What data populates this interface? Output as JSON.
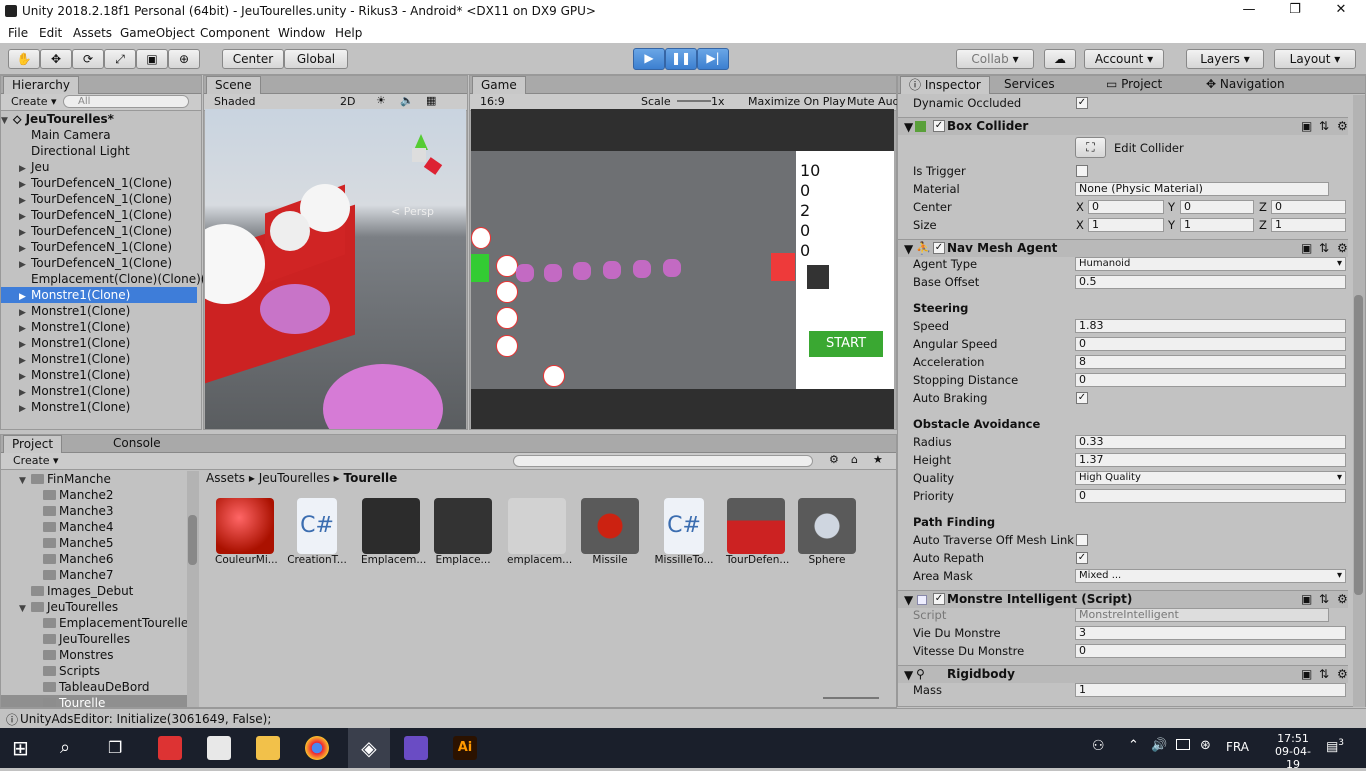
{
  "window": {
    "title": "Unity 2018.2.18f1 Personal (64bit) - JeuTourelles.unity - Rikus3 - Android* <DX11 on DX9 GPU>"
  },
  "menu": [
    "File",
    "Edit",
    "Assets",
    "GameObject",
    "Component",
    "Window",
    "Help"
  ],
  "toolbar": {
    "center": "Center",
    "global": "Global",
    "collab": "Collab",
    "account": "Account",
    "layers": "Layers",
    "layout": "Layout"
  },
  "hierarchy": {
    "tab": "Hierarchy",
    "create": "Create",
    "search_placeholder": "All",
    "scene": "JeuTourelles*",
    "items": [
      "Main Camera",
      "Directional Light",
      "Jeu",
      "TourDefenceN_1(Clone)",
      "TourDefenceN_1(Clone)",
      "TourDefenceN_1(Clone)",
      "TourDefenceN_1(Clone)",
      "TourDefenceN_1(Clone)",
      "TourDefenceN_1(Clone)",
      "Emplacement(Clone)(Clone)(",
      "Monstre1(Clone)",
      "Monstre1(Clone)",
      "Monstre1(Clone)",
      "Monstre1(Clone)",
      "Monstre1(Clone)",
      "Monstre1(Clone)",
      "Monstre1(Clone)",
      "Monstre1(Clone)"
    ]
  },
  "scene": {
    "tab": "Scene",
    "shading": "Shaded",
    "mode2d": "2D",
    "persp": "Persp"
  },
  "game": {
    "tab": "Game",
    "aspect": "16:9",
    "scale_label": "Scale",
    "scale_value": "1x",
    "maximize": "Maximize On Play",
    "mute": "Mute Aud",
    "scores": [
      "10",
      "0",
      "2",
      "0",
      "0"
    ],
    "start": "START"
  },
  "project": {
    "tab": "Project",
    "console_tab": "Console",
    "create": "Create",
    "tree": [
      "FinManche",
      "Manche2",
      "Manche3",
      "Manche4",
      "Manche5",
      "Manche6",
      "Manche7",
      "Images_Debut",
      "JeuTourelles",
      "EmplacementTourelle",
      "JeuTourelles",
      "Monstres",
      "Scripts",
      "TableauDeBord",
      "Tourelle"
    ],
    "breadcrumb": [
      "Assets",
      "JeuTourelles",
      "Tourelle"
    ],
    "assets": [
      "CouleurMi...",
      "CreationT...",
      "Emplacem...",
      "Emplace...",
      "emplacem...",
      "Missile",
      "MissilleTo...",
      "TourDefen...",
      "Sphere"
    ]
  },
  "inspector": {
    "tabs": [
      "Inspector",
      "Services",
      "Project",
      "Navigation"
    ],
    "dynamic_occluded": "Dynamic Occluded",
    "box_collider": {
      "title": "Box Collider",
      "edit": "Edit Collider",
      "is_trigger": "Is Trigger",
      "material_label": "Material",
      "material": "None (Physic Material)",
      "center": "Center",
      "center_x": "0",
      "center_y": "0",
      "center_z": "0",
      "size": "Size",
      "size_x": "1",
      "size_y": "1",
      "size_z": "1"
    },
    "nav": {
      "title": "Nav Mesh Agent",
      "agent_type": "Agent Type",
      "agent_type_val": "Humanoid",
      "base_offset": "Base Offset",
      "base_offset_val": "0.5",
      "steering": "Steering",
      "speed": "Speed",
      "speed_val": "1.83",
      "angular": "Angular Speed",
      "angular_val": "0",
      "accel": "Acceleration",
      "accel_val": "8",
      "stopping": "Stopping Distance",
      "stopping_val": "0",
      "braking": "Auto Braking",
      "obstacle": "Obstacle Avoidance",
      "radius": "Radius",
      "radius_val": "0.33",
      "height": "Height",
      "height_val": "1.37",
      "quality": "Quality",
      "quality_val": "High Quality",
      "priority": "Priority",
      "priority_val": "0",
      "path": "Path Finding",
      "traverse": "Auto Traverse Off Mesh Link",
      "repath": "Auto Repath",
      "area": "Area Mask",
      "area_val": "Mixed ..."
    },
    "script": {
      "title": "Monstre Intelligent (Script)",
      "script_label": "Script",
      "script_val": "MonstreIntelligent",
      "vie": "Vie Du Monstre",
      "vie_val": "3",
      "vitesse": "Vitesse Du Monstre",
      "vitesse_val": "0"
    },
    "rigidbody": {
      "title": "Rigidbody",
      "mass": "Mass",
      "mass_val": "1"
    }
  },
  "status": "UnityAdsEditor: Initialize(3061649, False);",
  "taskbar": {
    "lang": "FRA",
    "time": "17:51",
    "date": "09-04-19",
    "notif": "3"
  }
}
